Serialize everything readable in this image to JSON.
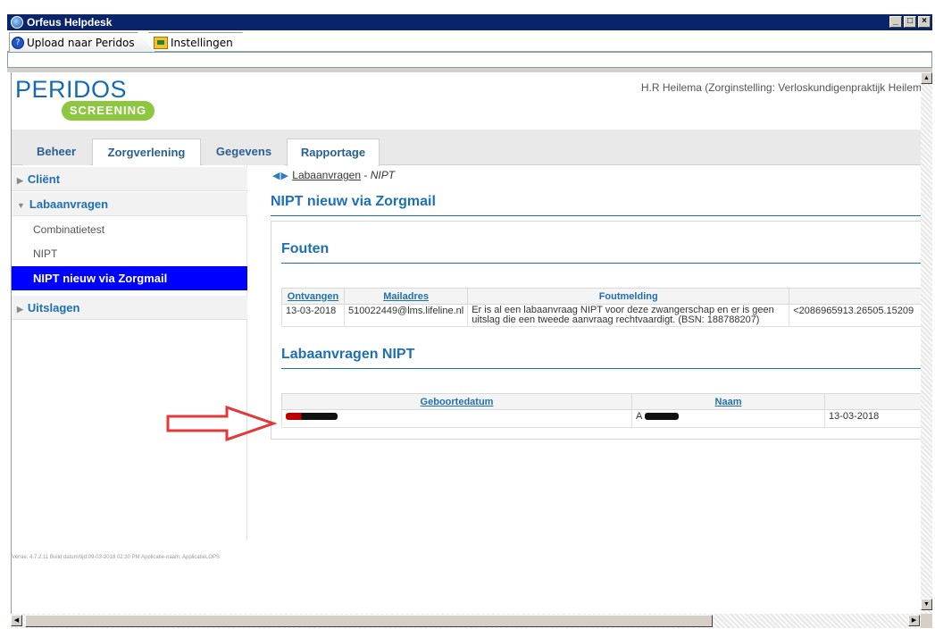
{
  "window": {
    "title": "Orfeus Helpdesk",
    "min": "_",
    "max": "□",
    "close": "×"
  },
  "toolbar": {
    "upload_label": "Upload naar Peridos",
    "settings_label": "Instellingen"
  },
  "header": {
    "logo_text": "PERIDOS",
    "logo_sub": "SCREENING",
    "user_info": "H.R Heilema (Zorginstelling: Verloskundigenpraktijk Heilem"
  },
  "nav": {
    "tabs": [
      "Beheer",
      "Zorgverlening",
      "Gegevens",
      "Rapportage"
    ],
    "active": "Zorgverlening"
  },
  "sidebar": {
    "client": "Cliënt",
    "labaanvragen": "Labaanvragen",
    "combinatietest": "Combinatietest",
    "nipt": "NIPT",
    "nipt_zorgmail": "NIPT nieuw via Zorgmail",
    "uitslagen": "Uitslagen"
  },
  "content": {
    "breadcrumb_link": "Labaanvragen",
    "breadcrumb_sep": " - ",
    "breadcrumb_current": "NIPT",
    "page_title": "NIPT nieuw via Zorgmail",
    "errors_title": "Fouten",
    "errors_table": {
      "headers": [
        "Ontvangen",
        "Mailadres",
        "Foutmelding",
        ""
      ],
      "rows": [
        {
          "ontvangen": "13-03-2018",
          "mailadres": "510022449@lms.lifeline.nl",
          "foutmelding": "Er is al een labaanvraag NIPT voor deze zwangerschap en er is geen uitslag die een tweede aanvraag rechtvaardigt. (BSN: 188788207)",
          "extra": "<2086965913.26505.15209"
        }
      ]
    },
    "lab_title": "Labaanvragen NIPT",
    "lab_table": {
      "headers": [
        "Geboortedatum",
        "Naam",
        ""
      ],
      "rows": [
        {
          "naam_prefix": "A",
          "datum": "13-03-2018"
        }
      ]
    }
  },
  "footer": {
    "version_text": "Versie: 4.7.2.11 Build datum/tijd:09-03-2018 02:30 PM Applicatie-naam: ApplicatieLOPS"
  },
  "colors": {
    "accent_blue": "#1e6fb3",
    "selected_blue": "#0000ff",
    "annotation_red": "#e23a3a",
    "logo_green": "#8dc63f"
  }
}
